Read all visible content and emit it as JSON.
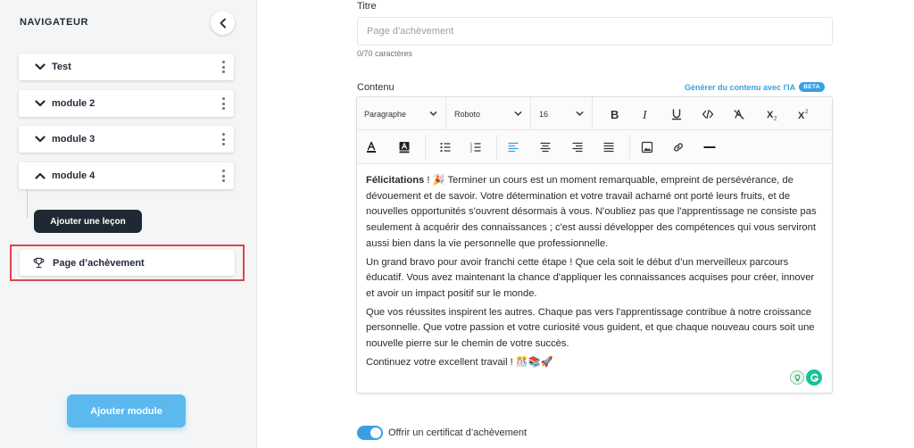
{
  "sidebar": {
    "title": "NAVIGATEUR",
    "modules": [
      {
        "label": "Test",
        "expanded": false
      },
      {
        "label": "module 2",
        "expanded": false
      },
      {
        "label": "module 3",
        "expanded": false
      },
      {
        "label": "module 4",
        "expanded": true
      }
    ],
    "add_lesson_label": "Ajouter une leçon",
    "completion_page_label": "Page d’achèvement",
    "add_module_label": "Ajouter module"
  },
  "form": {
    "title_label": "Titre",
    "title_placeholder": "Page d’achèvement",
    "title_value": "",
    "char_count": "0/70 caractères",
    "content_label": "Contenu",
    "ai_link": "Générer du contenu avec l'IA",
    "ai_badge": "BETA"
  },
  "toolbar": {
    "block_format": "Paragraphe",
    "font_family": "Roboto",
    "font_size": "16"
  },
  "content": {
    "p1_bold": "Félicitations",
    "p1_rest": " ! 🎉 Terminer un cours est un moment remarquable, empreint de persévérance, de dévouement et de savoir. Votre détermination et votre travail acharné ont porté leurs fruits, et de nouvelles opportunités s'ouvrent désormais à vous. N'oubliez pas que l'apprentissage ne consiste pas seulement à acquérir des connaissances ; c'est aussi développer des compétences qui vous serviront aussi bien dans la vie personnelle que professionnelle.",
    "p2": "Un grand bravo pour avoir franchi cette étape ! Que cela soit le début d’un merveilleux parcours éducatif. Vous avez maintenant la chance d'appliquer les connaissances acquises pour créer, innover et avoir un impact positif sur le monde.",
    "p3": "Que vos réussites inspirent les autres. Chaque pas vers l'apprentissage contribue à notre croissance personnelle. Que votre passion et votre curiosité vous guident, et que chaque nouveau cours soit une nouvelle pierre sur le chemin de votre succès.",
    "p4": "Continuez votre excellent travail ! 🎊📚🚀"
  },
  "certificate": {
    "label": "Offrir un certificat d’achèvement",
    "enabled": true
  },
  "colors": {
    "accent": "#3b9fe0",
    "add_module_button": "#5bb9ee",
    "highlight_border": "#e2434b",
    "dark_button": "#1f2933",
    "grammarly": "#15c39a"
  }
}
